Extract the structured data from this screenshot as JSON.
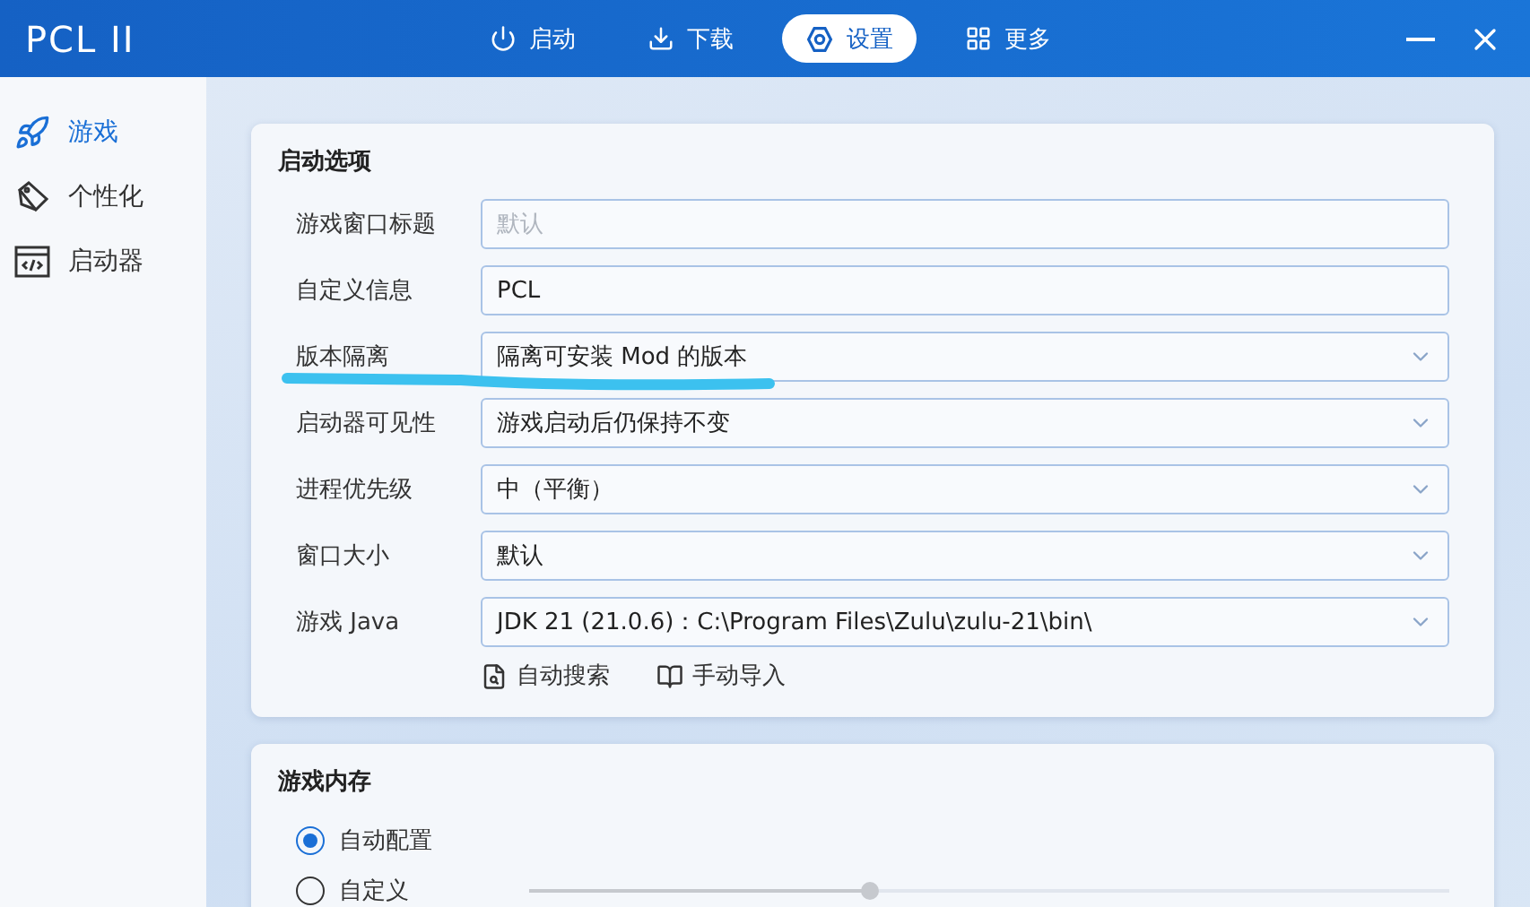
{
  "window": {
    "title": "PCL II"
  },
  "nav_tabs": [
    {
      "label": "启动",
      "selected": false
    },
    {
      "label": "下载",
      "selected": false
    },
    {
      "label": "设置",
      "selected": true
    },
    {
      "label": "更多",
      "selected": false
    }
  ],
  "sidebar": {
    "items": [
      {
        "label": "游戏",
        "selected": true
      },
      {
        "label": "个性化",
        "selected": false
      },
      {
        "label": "启动器",
        "selected": false
      }
    ]
  },
  "launch_options": {
    "title": "启动选项",
    "rows": [
      {
        "label": "游戏窗口标题",
        "kind": "text",
        "placeholder": "默认"
      },
      {
        "label": "自定义信息",
        "kind": "text",
        "value": "PCL"
      },
      {
        "label": "版本隔离",
        "kind": "select",
        "value": "隔离可安装 Mod 的版本",
        "annotated": true
      },
      {
        "label": "启动器可见性",
        "kind": "select",
        "value": "游戏启动后仍保持不变"
      },
      {
        "label": "进程优先级",
        "kind": "select",
        "value": "中（平衡）"
      },
      {
        "label": "窗口大小",
        "kind": "select",
        "value": "默认"
      },
      {
        "label": "游戏 Java",
        "kind": "select",
        "value": "JDK 21 (21.0.6)：C:\\Program Files\\Zulu\\zulu-21\\bin\\"
      }
    ],
    "actions": [
      {
        "label": "自动搜索"
      },
      {
        "label": "手动导入"
      }
    ]
  },
  "memory": {
    "title": "游戏内存",
    "options": [
      {
        "label": "自动配置",
        "selected": true
      },
      {
        "label": "自定义",
        "selected": false,
        "slider": {
          "level": 0.37
        }
      }
    ]
  }
}
